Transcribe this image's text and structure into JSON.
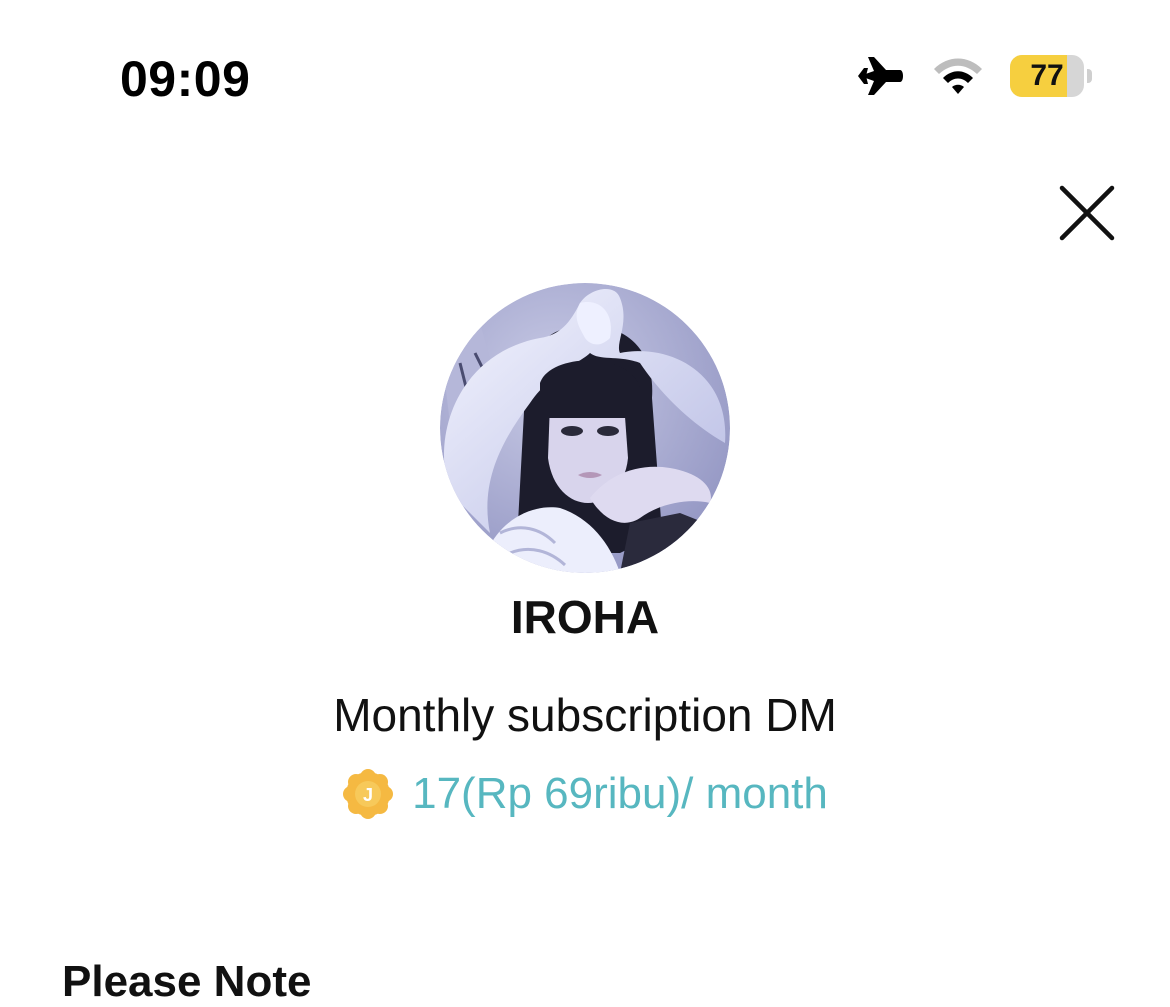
{
  "status_bar": {
    "time": "09:09",
    "battery_level": "77",
    "battery_percent": 77,
    "icons": [
      "airplane-icon",
      "wifi-icon",
      "battery-icon"
    ]
  },
  "header": {
    "close_icon": "close-icon"
  },
  "profile": {
    "name": "IROHA",
    "avatar": "profile-photo"
  },
  "subscription": {
    "title": "Monthly subscription DM",
    "coin_letter": "J",
    "price": "17(Rp 69ribu)/ month",
    "price_color": "#57b7c0",
    "coin_color": "#f5b942"
  },
  "notes": {
    "heading": "Please Note"
  }
}
